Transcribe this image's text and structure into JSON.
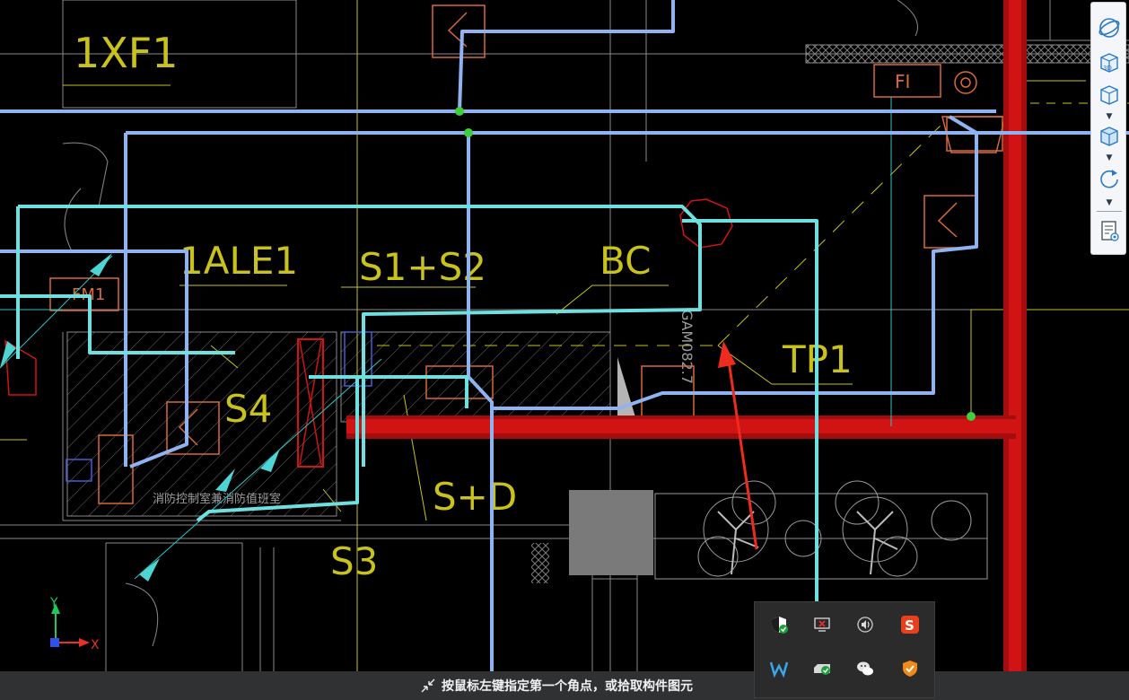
{
  "drawing": {
    "labels": {
      "panel_1xf1": "1XF1",
      "panel_1ale1": "1ALE1",
      "s1_s2": "S1+S2",
      "bc": "BC",
      "tp1": "TP1",
      "s4": "S4",
      "s_d": "S+D",
      "s3": "S3",
      "fi": "FI",
      "fm1": "FM1",
      "gam": "GAM082.7",
      "shop_note": "消防控制室兼消防值班室"
    },
    "colors": {
      "background": "#000000",
      "duct_blue": "#8fb3f0",
      "duct_cyan": "#6ee0e0",
      "wall_red": "#d21313",
      "annotation_yellow": "#c9c21a",
      "equipment_orange": "#d9683a",
      "arrow_red": "#ee2b1f"
    }
  },
  "axes": {
    "x_label": "X",
    "y_label": "Y"
  },
  "view_toolbar": {
    "buttons": [
      {
        "name": "orbit-button",
        "icon": "orbit-icon"
      },
      {
        "name": "view-3d-button",
        "icon": "cube-3d-icon",
        "label": "3D"
      },
      {
        "name": "view-cube-button",
        "icon": "cube-icon"
      },
      {
        "name": "view-cube-2-button",
        "icon": "cube-solid-icon"
      },
      {
        "name": "rotate-button",
        "icon": "rotate-icon"
      },
      {
        "name": "properties-button",
        "icon": "document-view-icon"
      }
    ]
  },
  "status_bar": {
    "prompt": "按鼠标左键指定第一个角点，或拾取构件图元",
    "prompt_icon": "corner-select-icon"
  },
  "tray": {
    "icons": [
      "shield-check-icon",
      "network-error-icon",
      "speaker-icon",
      "sogou-input-icon",
      "app-w-icon",
      "drive-check-icon",
      "wechat-icon",
      "security-shield-icon"
    ]
  }
}
